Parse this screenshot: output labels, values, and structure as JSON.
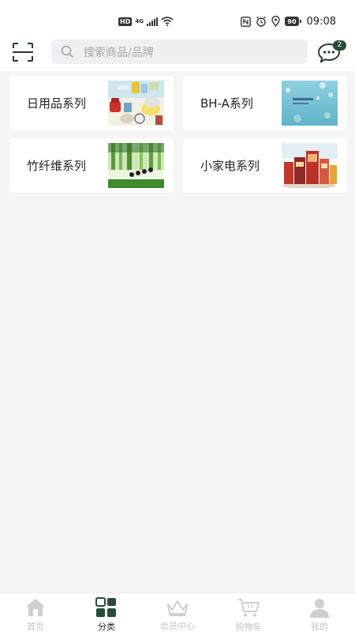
{
  "status_bar": {
    "network": "4G",
    "hd": "HD",
    "battery": "90",
    "time": "09:08"
  },
  "header": {
    "search_placeholder": "搜索商品/品牌",
    "message_count": "2"
  },
  "categories": [
    {
      "label": "日用品系列"
    },
    {
      "label": "BH-A系列"
    },
    {
      "label": "竹纤维系列"
    },
    {
      "label": "小家电系列"
    }
  ],
  "tabs": [
    {
      "label": "首页",
      "icon": "home-icon"
    },
    {
      "label": "分类",
      "icon": "category-icon"
    },
    {
      "label": "会员中心",
      "icon": "crown-icon"
    },
    {
      "label": "购物车",
      "icon": "cart-icon"
    },
    {
      "label": "我的",
      "icon": "user-icon"
    }
  ],
  "colors": {
    "accent": "#2a4a3a",
    "inactive": "#c3c3c3"
  }
}
